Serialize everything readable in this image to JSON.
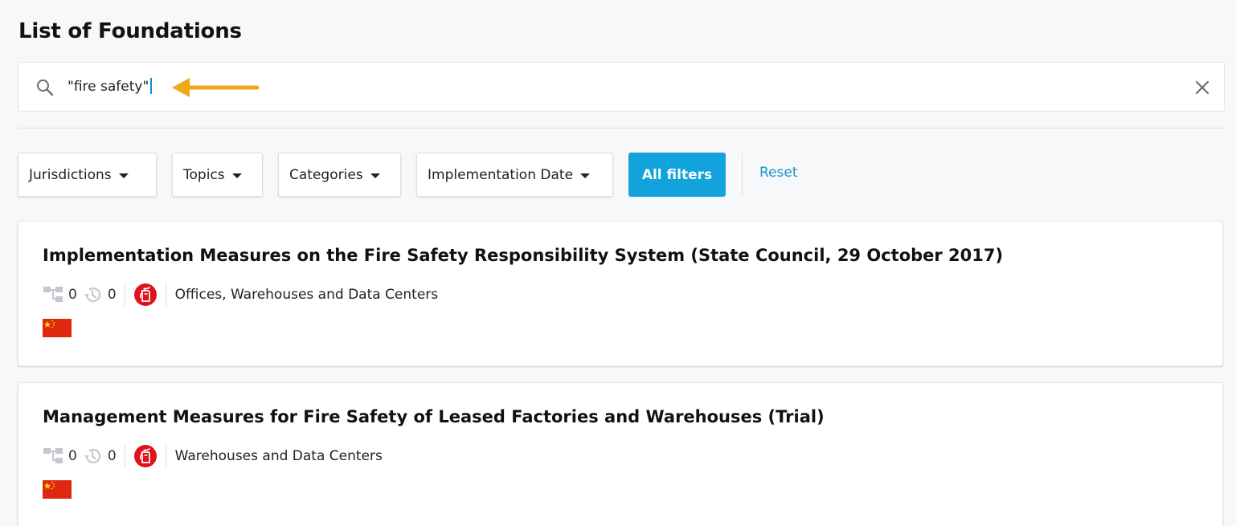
{
  "page": {
    "title": "List of Foundations"
  },
  "search": {
    "value": "\"fire safety\""
  },
  "filters": {
    "jurisdictions": "Jurisdictions",
    "topics": "Topics",
    "categories": "Categories",
    "implementation_date": "Implementation Date",
    "all_filters": "All filters",
    "reset": "Reset"
  },
  "results": [
    {
      "title": "Implementation Measures on the Fire Safety Responsibility System (State Council, 29 October 2017)",
      "related_count": "0",
      "history_count": "0",
      "category": "Offices, Warehouses and Data Centers",
      "topic_icon": "fire-extinguisher-icon",
      "jurisdiction_flag": "china-flag"
    },
    {
      "title": "Management Measures for Fire Safety of Leased Factories and Warehouses (Trial)",
      "related_count": "0",
      "history_count": "0",
      "category": "Warehouses and Data Centers",
      "topic_icon": "fire-extinguisher-icon",
      "jurisdiction_flag": "china-flag"
    }
  ],
  "colors": {
    "accent": "#12a2dc",
    "link": "#1a94c8",
    "annotation_arrow": "#f0a818",
    "topic_badge": "#e0121c",
    "flag_red": "#de2910",
    "flag_yellow": "#ffde00"
  }
}
